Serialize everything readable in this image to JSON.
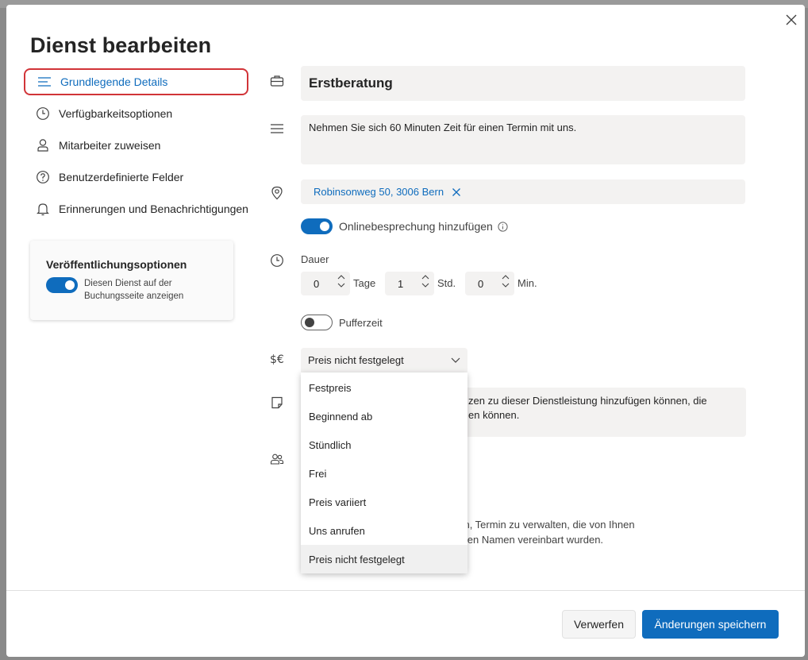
{
  "dialog": {
    "title": "Dienst bearbeiten",
    "close_icon": "close-icon"
  },
  "nav": {
    "items": [
      {
        "label": "Grundlegende Details",
        "icon": "lines-icon",
        "active": true
      },
      {
        "label": "Verfügbarkeitsoptionen",
        "icon": "clock-icon",
        "active": false
      },
      {
        "label": "Mitarbeiter zuweisen",
        "icon": "person-icon",
        "active": false
      },
      {
        "label": "Benutzerdefinierte Felder",
        "icon": "question-icon",
        "active": false
      },
      {
        "label": "Erinnerungen und Benachrichtigungen",
        "icon": "bell-icon",
        "active": false
      }
    ]
  },
  "publish": {
    "title": "Veröffentlichungsoptionen",
    "toggle_on": true,
    "description": "Diesen Dienst auf der Buchungsseite anzeigen"
  },
  "form": {
    "service_name": "Erstberatung",
    "description": "Nehmen Sie sich 60 Minuten Zeit für einen Termin mit uns.",
    "location": "Robinsonweg 50, 3006 Bern",
    "online_meeting": {
      "label": "Onlinebesprechung hinzufügen",
      "on": true
    },
    "duration": {
      "label": "Dauer",
      "days": "0",
      "days_unit": "Tage",
      "hours": "1",
      "hours_unit": "Std.",
      "minutes": "0",
      "minutes_unit": "Min."
    },
    "buffer": {
      "label": "Pufferzeit",
      "on": false
    },
    "price": {
      "selected": "Preis nicht festgelegt",
      "options": [
        "Festpreis",
        "Beginnend ab",
        "Stündlich",
        "Frei",
        "Preis variiert",
        "Uns anrufen",
        "Preis nicht festgelegt"
      ]
    },
    "notes_partial": "zen zu dieser Dienstleistung hinzufügen können, die\nen können.",
    "staff_partial_line1": "den, Termin zu verwalten, die von Ihnen",
    "staff_partial_line2": "deren Namen vereinbart wurden."
  },
  "footer": {
    "discard": "Verwerfen",
    "save": "Änderungen speichern"
  },
  "colors": {
    "accent": "#0f6cbd",
    "highlight_border": "#d13438"
  }
}
